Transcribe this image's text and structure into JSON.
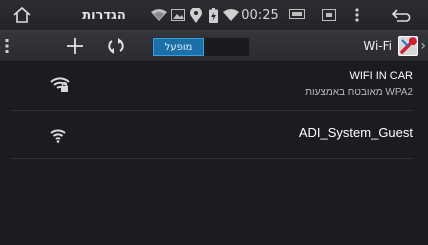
{
  "status_bar": {
    "title": "הגדרות",
    "time": "00:25",
    "icons": [
      "home-icon",
      "wifi-status-icon",
      "image-icon",
      "location-icon",
      "battery-icon",
      "wifi-signal-icon",
      "monitor-icon",
      "screenshot-icon",
      "menu-icon",
      "back-icon"
    ]
  },
  "action_bar": {
    "icons": [
      "overflow-menu-icon",
      "add-icon",
      "refresh-icon"
    ],
    "toggle_label": "מופעל",
    "toggle_state": "on",
    "title": "Wi-Fi",
    "accent": "#1d6fa8"
  },
  "networks": [
    {
      "ssid": "WIFI IN CAR",
      "detail": "מאובטח באמצעות WPA2",
      "secured": true
    },
    {
      "ssid": "ADI_System_Guest",
      "secured": false
    }
  ]
}
